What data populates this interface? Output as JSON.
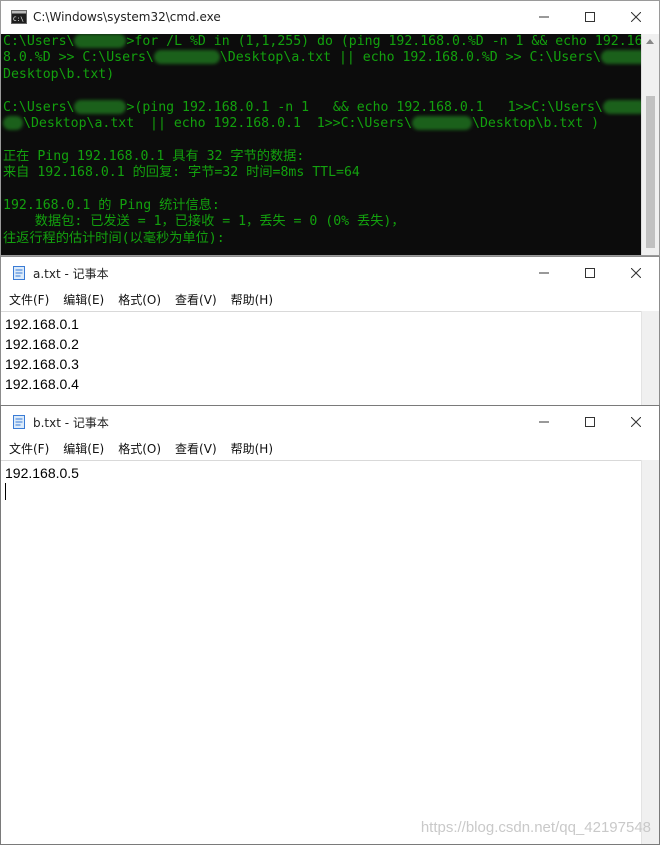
{
  "cmd": {
    "title": "C:\\Windows\\system32\\cmd.exe",
    "lines": [
      [
        "C:\\Users\\",
        "",
        ">for /L %D in (1,1,255) do (ping 192.168.0.%D -n 1 && echo 192.16"
      ],
      [
        "8.0.%D >> C:\\Users\\",
        "",
        "\\Desktop\\a.txt || echo 192.168.0.%D >> C:\\Users\\",
        "",
        "\\"
      ],
      [
        "Desktop\\b.txt)"
      ],
      [
        ""
      ],
      [
        "C:\\Users\\",
        "",
        ">(ping 192.168.0.1 -n 1   && echo 192.168.0.1   1>>C:\\Users\\",
        ""
      ],
      [
        "",
        "\\Desktop\\a.txt  || echo 192.168.0.1  1>>C:\\Users\\",
        "",
        "\\Desktop\\b.txt )"
      ],
      [
        ""
      ],
      [
        "正在 Ping 192.168.0.1 具有 32 字节的数据:"
      ],
      [
        "来自 192.168.0.1 的回复: 字节=32 时间=8ms TTL=64"
      ],
      [
        ""
      ],
      [
        "192.168.0.1 的 Ping 统计信息:"
      ],
      [
        "    数据包: 已发送 = 1，已接收 = 1，丢失 = 0 (0% 丢失)，"
      ],
      [
        "往返行程的估计时间(以毫秒为单位):"
      ]
    ]
  },
  "notepad_a": {
    "title": "a.txt - 记事本",
    "menu": [
      "文件(F)",
      "编辑(E)",
      "格式(O)",
      "查看(V)",
      "帮助(H)"
    ],
    "lines": [
      "192.168.0.1",
      "192.168.0.2",
      "192.168.0.3",
      "192.168.0.4"
    ]
  },
  "notepad_b": {
    "title": "b.txt - 记事本",
    "menu": [
      "文件(F)",
      "编辑(E)",
      "格式(O)",
      "查看(V)",
      "帮助(H)"
    ],
    "lines": [
      "192.168.0.5"
    ]
  },
  "watermark": "https://blog.csdn.net/qq_42197548"
}
